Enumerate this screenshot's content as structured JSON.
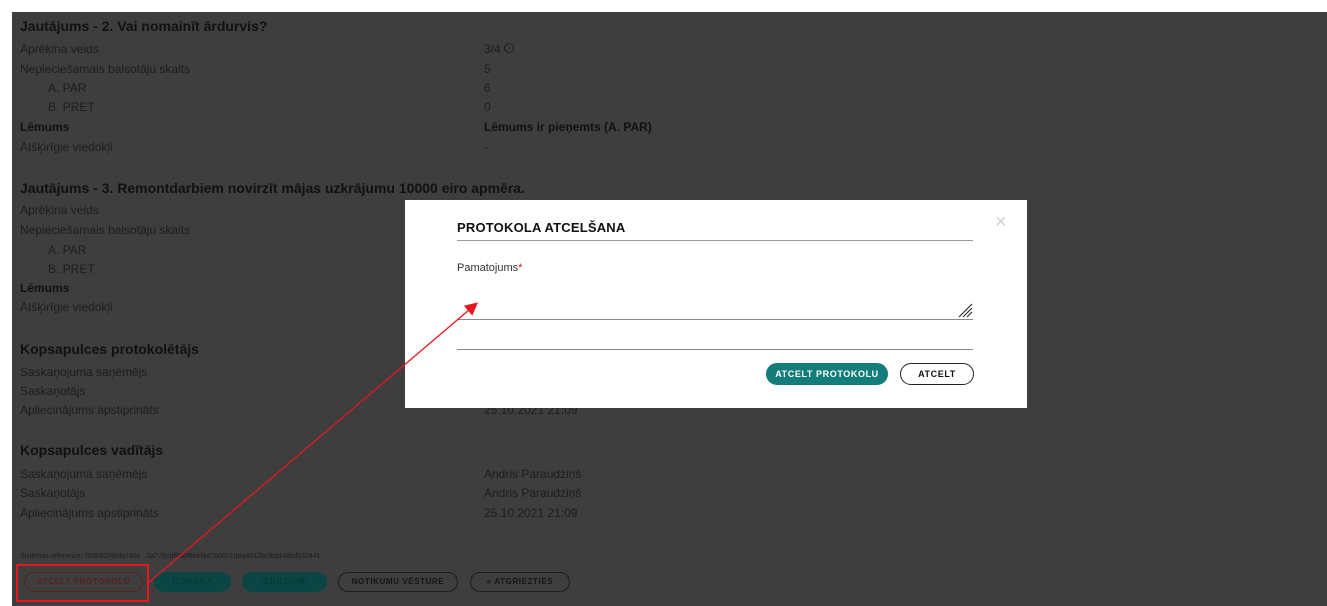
{
  "q2": {
    "title": "Jautājums - 2. Vai nomainīt ārdurvis?",
    "rows": [
      {
        "label": "Aprēķina veids",
        "value": "3/4"
      },
      {
        "label": "Nepieciešamais balsotāju skaits",
        "value": "5"
      },
      {
        "label": "A. PAR",
        "value": "6"
      },
      {
        "label": "B. PRET",
        "value": "0"
      },
      {
        "label": "Lēmums",
        "value": "Lēmums ir pieņemts (A. PAR)"
      },
      {
        "label": "Atšķirīgie viedokļi",
        "value": "-"
      }
    ]
  },
  "q3": {
    "title": "Jautājums - 3. Remontdarbiem novirzīt mājas uzkrājumu 10000 eiro apmēra.",
    "rows": [
      {
        "label": "Aprēķina veids"
      },
      {
        "label": "Nepieciešamais balsotāju skaits"
      },
      {
        "label": "A. PAR"
      },
      {
        "label": "B. PRET"
      },
      {
        "label": "Lēmums"
      },
      {
        "label": "Atšķirīgie viedokļi"
      }
    ]
  },
  "recorder": {
    "title": "Kopsapulces protokolētājs",
    "rows": [
      {
        "label": "Saskaņojuma saņēmējs"
      },
      {
        "label": "Saskaņotājs"
      },
      {
        "label": "Apliecinājums apstiprināts",
        "value": "25.10.2021 21:09"
      }
    ]
  },
  "chair": {
    "title": "Kopsapulces vadītājs",
    "rows": [
      {
        "label": "Saskaņojuma saņēmējs",
        "value": "Andris Paraudziņš"
      },
      {
        "label": "Saskaņotājs",
        "value": "Andris Paraudziņš"
      },
      {
        "label": "Apliecinājums apstiprināts",
        "value": "25.10.2021 21:09"
      }
    ]
  },
  "system_reference": "Sistēmas reference: 7b3092f48da786e...3a779cdf888f8befa42b0601dea4012bc6cbf48bd532441",
  "footer_buttons": {
    "cancel_protocol": "ATCELT PROTOKOLU",
    "print": "IZDRUKA",
    "objections": "IEBILDUMI",
    "history": "NOTIKUMU VĒSTURE",
    "back": "« ATGRIEZTIES"
  },
  "modal": {
    "title": "PROTOKOLA ATCELŠANA",
    "close": "×",
    "field_label": "Pamatojums",
    "required_mark": "*",
    "textarea_value": "",
    "primary_button": "ATCELT PROTOKOLU",
    "secondary_button": "ATCELT"
  },
  "colors": {
    "overlay_bg": "#3e3e3e",
    "teal": "#137d79",
    "highlight_red": "#e8171d"
  }
}
